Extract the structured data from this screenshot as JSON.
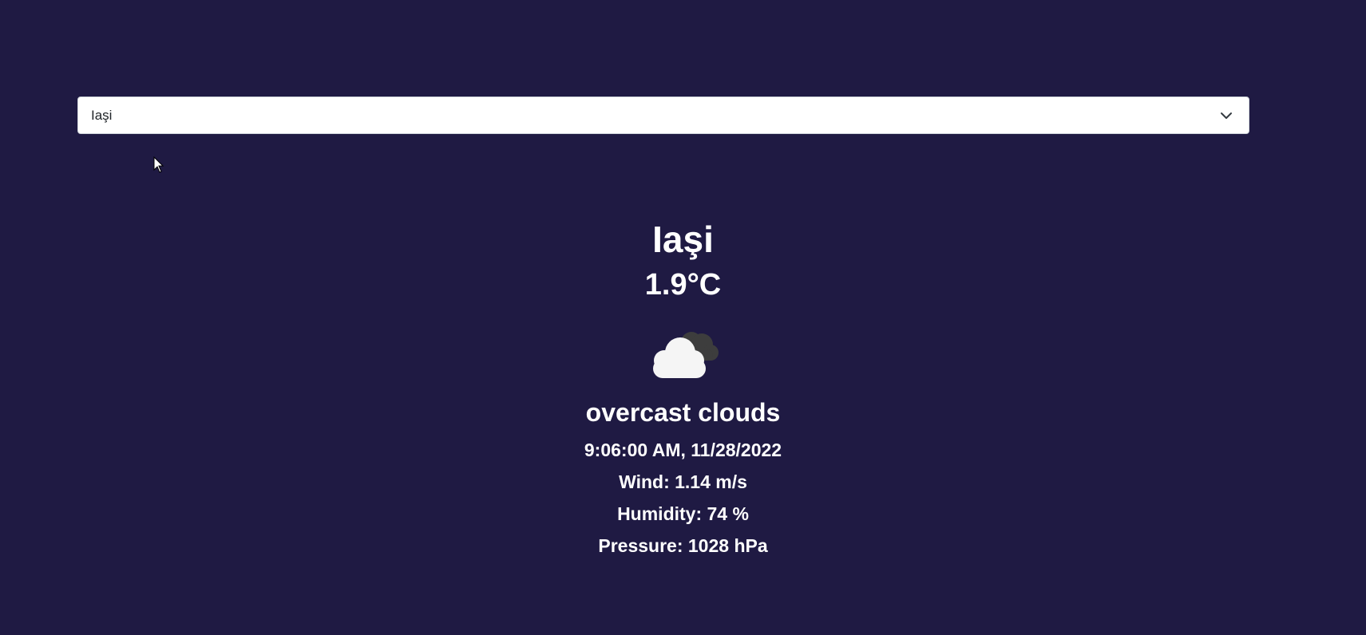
{
  "select": {
    "value": "Iaşi"
  },
  "weather": {
    "city": "Iaşi",
    "temperature": "1.9°C",
    "icon": "overcast-clouds-icon",
    "description": "overcast clouds",
    "datetime": "9:06:00 AM, 11/28/2022",
    "wind": "Wind: 1.14 m/s",
    "humidity": "Humidity: 74 %",
    "pressure": "Pressure: 1028 hPa"
  },
  "colors": {
    "background": "#1f1a43",
    "text": "#ffffff",
    "select_bg": "#ffffff"
  }
}
